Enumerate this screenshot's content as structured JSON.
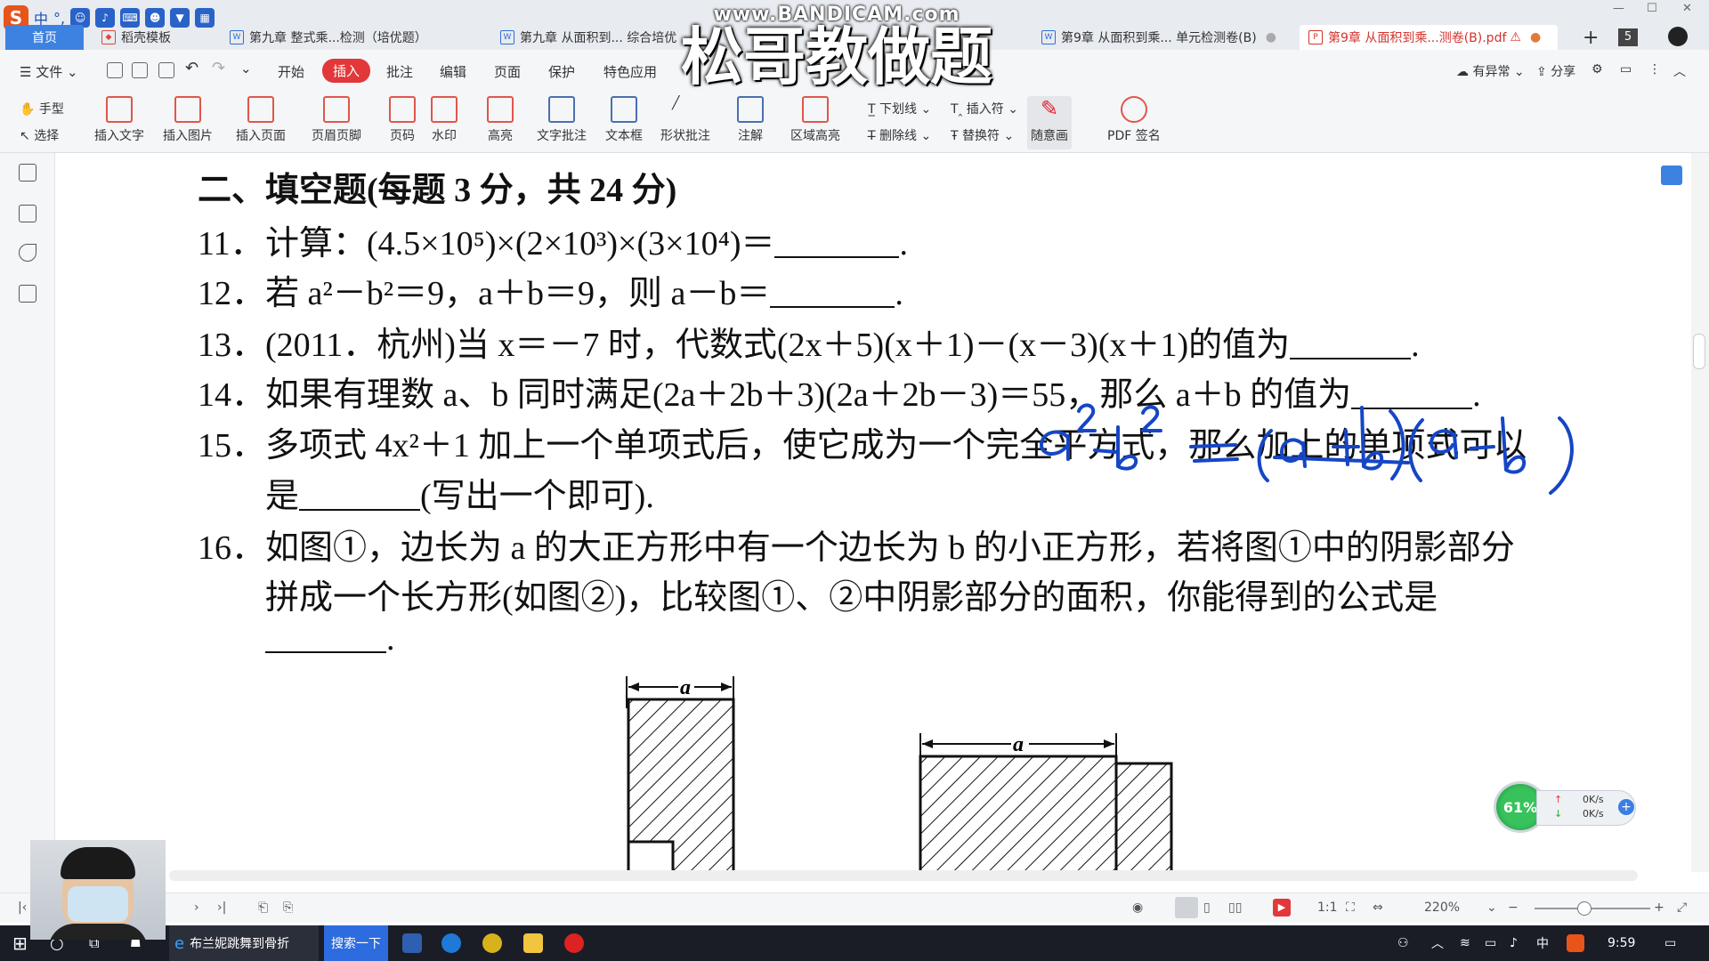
{
  "ime": {
    "logo": "S",
    "mode": "中",
    "punct": "°,"
  },
  "tabs": [
    {
      "label": "首页"
    },
    {
      "label": "稻壳模板"
    },
    {
      "label": "第九章 整式乘...检测（培优题）"
    },
    {
      "label": "第九章 从面积到... 综合培优"
    },
    {
      "label": "第9章 从面积到乘... 单元检测卷(B)"
    },
    {
      "label": "第9章 从面积到乘...测卷(B).pdf"
    }
  ],
  "tab_count": "5",
  "menu": {
    "file": "文件",
    "items": [
      "开始",
      "插入",
      "批注",
      "编辑",
      "页面",
      "保护",
      "特色应用"
    ],
    "active": "插入",
    "right": [
      "有异常",
      "分享"
    ]
  },
  "toolbar": {
    "hand": "手型",
    "select": "选择",
    "tools": [
      "插入文字",
      "插入图片",
      "插入页面",
      "页眉页脚",
      "页码",
      "水印",
      "高亮",
      "文字批注",
      "文本框",
      "形状批注",
      "注解",
      "区域高亮"
    ],
    "small": [
      "下划线",
      "插入符",
      "删除线",
      "替换符"
    ],
    "draw": "随意画",
    "sign": "PDF 签名"
  },
  "document": {
    "heading": "二、填空题(每题 3 分，共 24 分)",
    "questions": [
      {
        "num": "11．",
        "text": "计算：(4.5×10⁵)×(2×10³)×(3×10⁴)＝",
        "tail": "."
      },
      {
        "num": "12．",
        "text": "若 a²－b²＝9，a＋b＝9，则 a－b＝",
        "tail": "."
      },
      {
        "num": "13．",
        "text": "(2011．杭州)当 x＝－7 时，代数式(2x＋5)(x＋1)－(x－3)(x＋1)的值为",
        "tail": "."
      },
      {
        "num": "14．",
        "text": "如果有理数 a、b 同时满足(2a＋2b＋3)(2a＋2b－3)＝55，那么 a＋b 的值为",
        "tail": "."
      },
      {
        "num": "15．",
        "text": "多项式 4x²＋1 加上一个单项式后，使它成为一个完全平方式，那么加上的单项式可以",
        "line2_prefix": "是",
        "line2_suffix": "(写出一个即可)."
      },
      {
        "num": "16．",
        "text": "如图①，边长为 a 的大正方形中有一个边长为 b 的小正方形，若将图①中的阴影部分",
        "line2": "拼成一个长方形(如图②)，比较图①、②中阴影部分的面积，你能得到的公式是",
        "tail": "."
      }
    ],
    "figure_label_a": "a",
    "handwriting": "a²-b² = (a+b)(a-b)"
  },
  "statusbar": {
    "zoom": "220%"
  },
  "taskbar": {
    "browser_title": "布兰妮跳舞到骨折",
    "search": "搜索一下",
    "ime": "中",
    "clock": "9:59"
  },
  "overlay": {
    "watermark_top": "www.BANDICAM.com",
    "watermark_big": "松哥教做题",
    "speed_percent": "61%",
    "speed_up": "0K/s",
    "speed_down": "0K/s"
  }
}
